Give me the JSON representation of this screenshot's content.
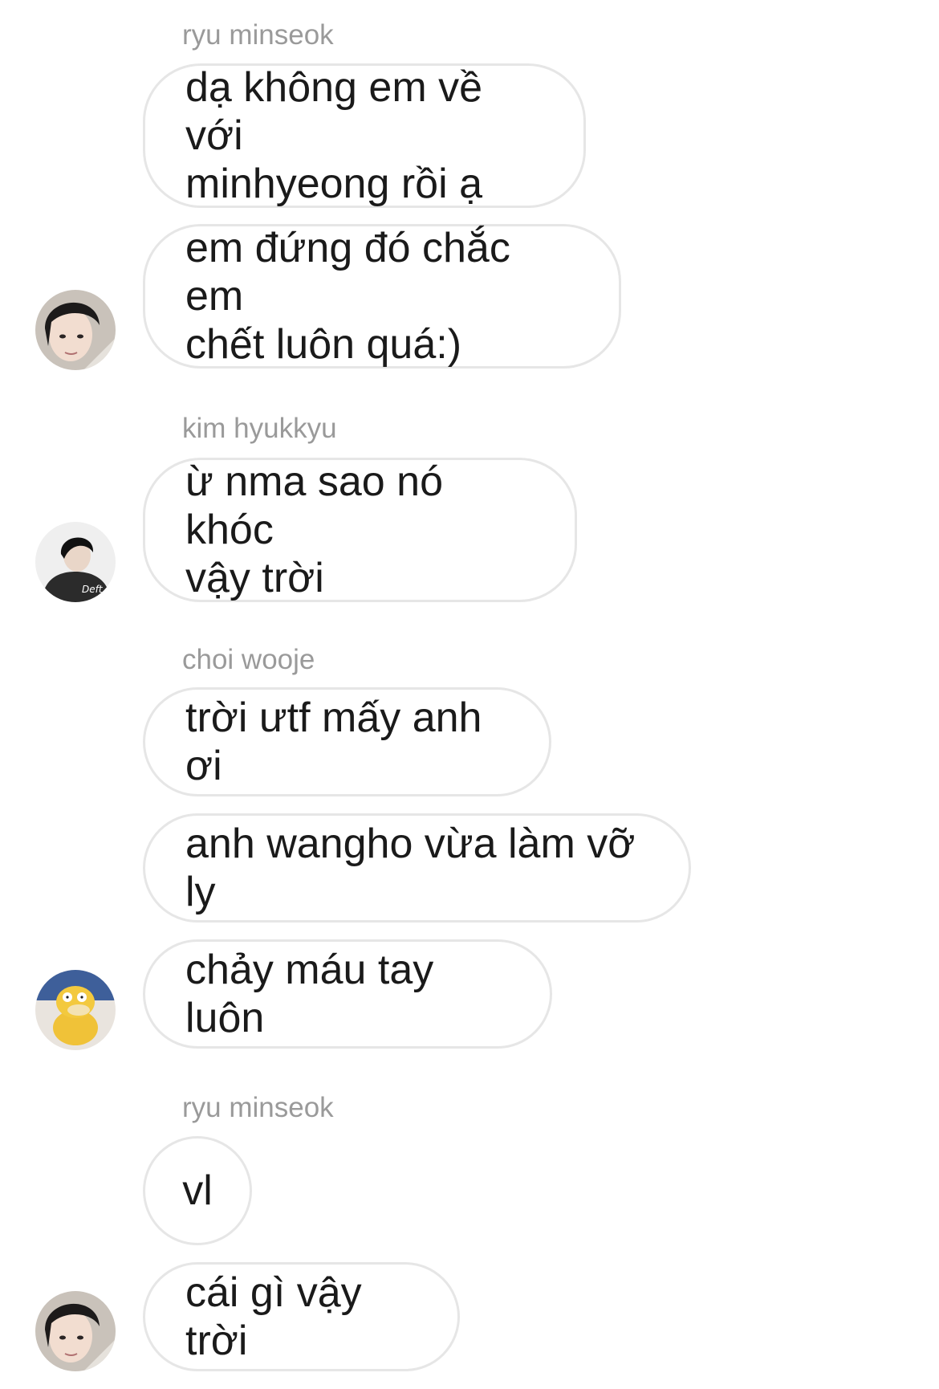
{
  "conversation": {
    "groups": [
      {
        "sender": "ryu minseok",
        "messages": [
          "dạ không em về với\nminhyeong rồi ạ",
          "em đứng đó chắc em\nchết luôn quá:)"
        ],
        "avatar": "person-photo-avatar"
      },
      {
        "sender": "kim hyukkyu",
        "messages": [
          "ừ nma sao nó khóc\nvậy trời"
        ],
        "avatar": "person-jacket-avatar",
        "avatar_badge": "Deft"
      },
      {
        "sender": "choi wooje",
        "messages": [
          "trời ưtf mấy anh ơi",
          "anh wangho vừa làm vỡ ly",
          "chảy máu tay luôn"
        ],
        "avatar": "psyduck-avatar"
      },
      {
        "sender": "ryu minseok",
        "messages": [
          "vl",
          "cái gì vậy trời"
        ],
        "avatar": "person-photo-avatar"
      }
    ]
  },
  "colors": {
    "background": "#ffffff",
    "bubble_border": "#e6e6e6",
    "sender_text": "#9a9a9a",
    "message_text": "#1a1a1a"
  }
}
